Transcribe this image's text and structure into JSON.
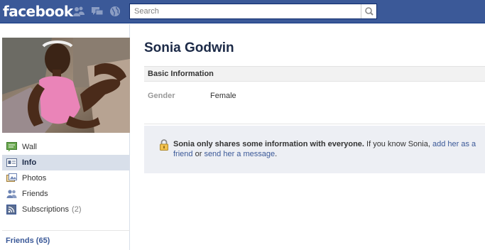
{
  "topbar": {
    "logo": "facebook",
    "search_placeholder": "Search",
    "jewels": [
      "friend-requests-icon",
      "messages-icon",
      "notifications-icon"
    ]
  },
  "profile": {
    "name": "Sonia Godwin"
  },
  "nav": {
    "items": [
      {
        "label": "Wall",
        "icon": "wall-icon",
        "active": false
      },
      {
        "label": "Info",
        "icon": "info-icon",
        "active": true
      },
      {
        "label": "Photos",
        "icon": "photos-icon",
        "active": false
      },
      {
        "label": "Friends",
        "icon": "friends-icon",
        "active": false
      },
      {
        "label": "Subscriptions",
        "icon": "subscriptions-icon",
        "count": "(2)",
        "active": false
      }
    ],
    "friends_link": "Friends (65)"
  },
  "info": {
    "section_title": "Basic Information",
    "gender_label": "Gender",
    "gender_value": "Female"
  },
  "notice": {
    "bold": "Sonia only shares some information with everyone.",
    "text1": " If you know Sonia, ",
    "link1": "add her as a friend",
    "text2": " or ",
    "link2": "send her a message",
    "text3": "."
  },
  "colors": {
    "brand": "#3b5998",
    "nav_active": "#d8dfea",
    "notice_bg": "#edeff4"
  }
}
